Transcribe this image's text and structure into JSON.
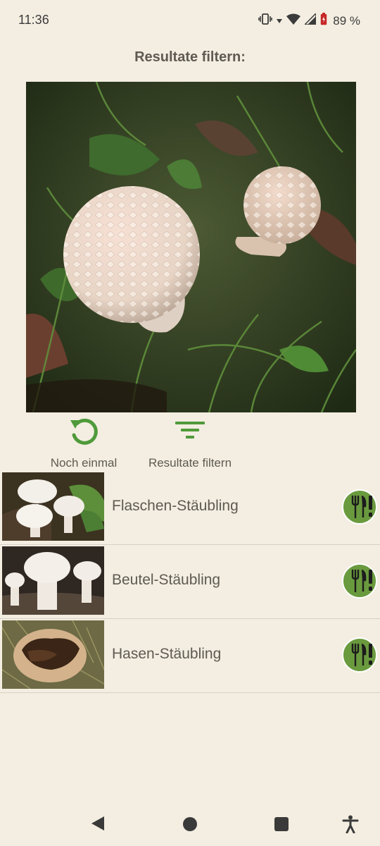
{
  "status": {
    "time": "11:36",
    "battery": "89 %",
    "icons": [
      "vibrate-icon",
      "wifi-icon",
      "signal-icon",
      "battery-icon"
    ]
  },
  "title": "Resultate filtern:",
  "actions": {
    "again_label": "Noch einmal",
    "filter_label": "Resultate filtern"
  },
  "results": [
    {
      "name": "Flaschen-Stäubling",
      "badge": "edible-warning-icon"
    },
    {
      "name": "Beutel-Stäubling",
      "badge": "edible-warning-icon"
    },
    {
      "name": "Hasen-Stäubling",
      "badge": "edible-warning-icon"
    }
  ],
  "colors": {
    "background": "#f3eee1",
    "accent_green": "#4f9a3a",
    "badge_green": "#6a9a3e",
    "text": "#5f5a52"
  },
  "nav": [
    "back-icon",
    "home-icon",
    "recents-icon",
    "accessibility-icon"
  ]
}
